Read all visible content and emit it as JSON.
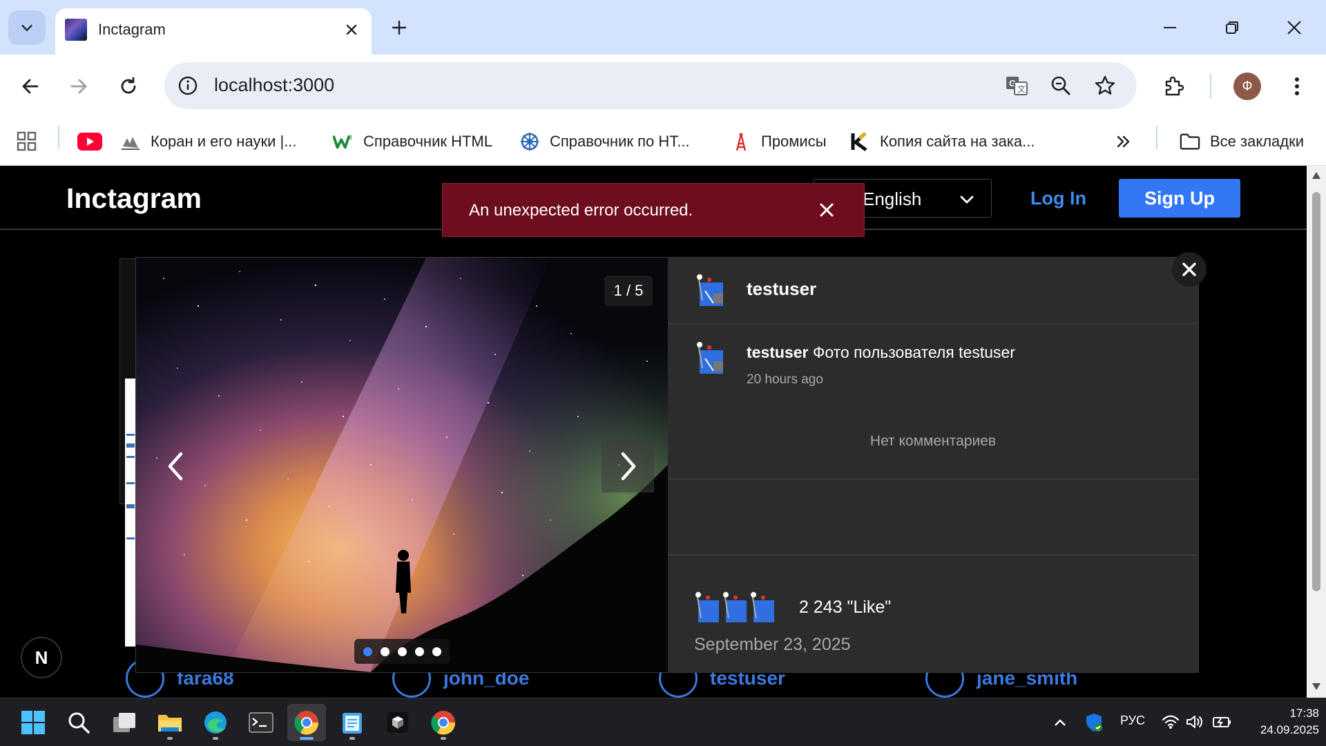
{
  "browser": {
    "tab_title": "Inctagram",
    "url": "localhost:3000",
    "profile_initial": "Ф"
  },
  "bookmarks": [
    {
      "label": "",
      "icon": "youtube-icon"
    },
    {
      "label": "Коран и его науки |...",
      "icon": "quran-icon"
    },
    {
      "label": "Справочник HTML",
      "icon": "w-icon"
    },
    {
      "label": "Справочник по HT...",
      "icon": "wheel-icon"
    },
    {
      "label": "Промисы",
      "icon": "tower-icon"
    },
    {
      "label": "Копия сайта на зака...",
      "icon": "k-icon"
    }
  ],
  "bookmarks_all": "Все закладки",
  "site": {
    "logo": "Inctagram",
    "language": "English",
    "login": "Log In",
    "signup": "Sign Up",
    "error_toast": "An unexpected error occurred."
  },
  "background_users": [
    "fara68",
    "john_doe",
    "testuser",
    "jane_smith"
  ],
  "post": {
    "counter": "1 / 5",
    "slides": 5,
    "active_slide": 1,
    "author": "testuser",
    "caption_user": "testuser",
    "caption_text": " Фото пользователя testuser",
    "time_ago": "20 hours ago",
    "no_comments": "Нет комментариев",
    "likes": "2 243 \"Like\"",
    "date": "September 23, 2025"
  },
  "taskbar": {
    "language": "РУС",
    "time": "17:38",
    "date": "24.09.2025"
  },
  "accent_color": "#3477f5",
  "error_color": "#6d0d1d"
}
